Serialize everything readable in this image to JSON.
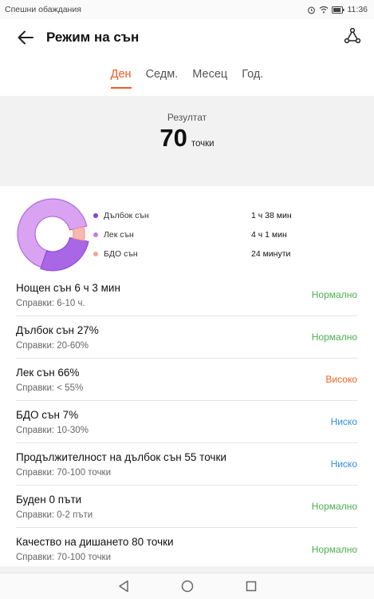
{
  "status_bar": {
    "carrier_text": "Спешни обаждания",
    "time": "11:36"
  },
  "app_bar": {
    "title": "Режим на сън"
  },
  "tabs": [
    {
      "label": "Ден",
      "active": true
    },
    {
      "label": "Седм.",
      "active": false
    },
    {
      "label": "Месец",
      "active": false
    },
    {
      "label": "Год.",
      "active": false
    }
  ],
  "score": {
    "label": "Резултат",
    "value": "70",
    "unit": "точки"
  },
  "summary": {
    "legend": [
      {
        "name": "Дълбок сън",
        "value": "1 ч 38 мин",
        "color": "#8a3fd6"
      },
      {
        "name": "Лек сън",
        "value": "4 ч 1 мин",
        "color": "#c57de8"
      },
      {
        "name": "БДО сън",
        "value": "24 минути",
        "color": "#f3a39a"
      }
    ],
    "shares": {
      "deep": 0.27,
      "light": 0.66,
      "rem": 0.07
    }
  },
  "metrics": [
    {
      "title": "Нощен сън  6 ч 3 мин",
      "ref": "Справки: 6-10 ч.",
      "status": "Нормално",
      "status_color": "#4caf50"
    },
    {
      "title": "Дълбок сън  27%",
      "ref": "Справки: 20-60%",
      "status": "Нормално",
      "status_color": "#4caf50"
    },
    {
      "title": "Лек сън  66%",
      "ref": "Справки: < 55%",
      "status": "Високо",
      "status_color": "#f06424"
    },
    {
      "title": "БДО сън  7%",
      "ref": "Справки: 10-30%",
      "status": "Ниско",
      "status_color": "#2f8fe3"
    },
    {
      "title": "Продължителност на дълбок сън  55 точки",
      "ref": "Справки: 70-100 точки",
      "status": "Ниско",
      "status_color": "#2f8fe3"
    },
    {
      "title": "Буден  0 пъти",
      "ref": "Справки: 0-2 пъти",
      "status": "Нормално",
      "status_color": "#4caf50"
    },
    {
      "title": "Качество на дишането  80 точки",
      "ref": "Справки: 70-100 точки",
      "status": "Нормално",
      "status_color": "#4caf50"
    }
  ],
  "colors": {
    "accent": "#f05a22",
    "normal": "#4caf50",
    "high": "#f06424",
    "low": "#2f8fe3"
  },
  "icons": {
    "back": "arrow-left-icon",
    "share": "share-icon",
    "nav_back": "triangle-back-icon",
    "nav_home": "circle-home-icon",
    "nav_recent": "square-recent-icon"
  }
}
